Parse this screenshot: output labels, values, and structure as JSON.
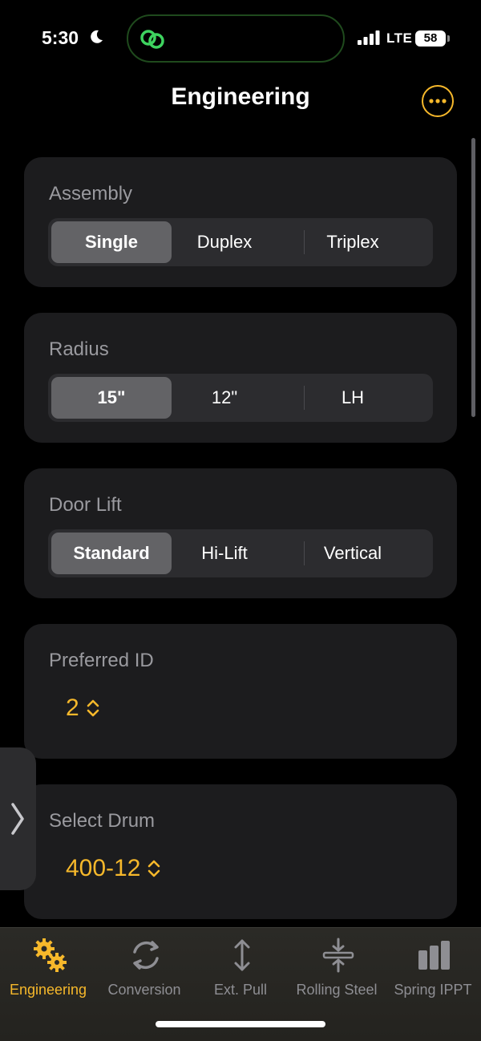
{
  "status_bar": {
    "time": "5:30",
    "network": "LTE",
    "battery": "58"
  },
  "header": {
    "title": "Engineering"
  },
  "cards": {
    "assembly": {
      "label": "Assembly",
      "options": [
        "Single",
        "Duplex",
        "Triplex"
      ],
      "selected": "Single"
    },
    "radius": {
      "label": "Radius",
      "options": [
        "15\"",
        "12\"",
        "LH"
      ],
      "selected": "15\""
    },
    "door_lift": {
      "label": "Door Lift",
      "options": [
        "Standard",
        "Hi-Lift",
        "Vertical"
      ],
      "selected": "Standard"
    },
    "preferred_id": {
      "label": "Preferred ID",
      "value": "2"
    },
    "select_drum": {
      "label": "Select Drum",
      "value": "400-12"
    }
  },
  "tab_bar": {
    "tabs": [
      {
        "label": "Engineering",
        "icon": "gears-icon",
        "active": true
      },
      {
        "label": "Conversion",
        "icon": "refresh-icon",
        "active": false
      },
      {
        "label": "Ext. Pull",
        "icon": "vertical-arrows-icon",
        "active": false
      },
      {
        "label": "Rolling Steel",
        "icon": "compress-icon",
        "active": false
      },
      {
        "label": "Spring IPPT",
        "icon": "bar-chart-icon",
        "active": false
      }
    ]
  },
  "colors": {
    "accent": "#f6b82b",
    "card_bg": "#1c1c1e",
    "segment_bg": "#2c2c2f",
    "segment_selected": "#636366",
    "label_gray": "#9a9a9f"
  }
}
